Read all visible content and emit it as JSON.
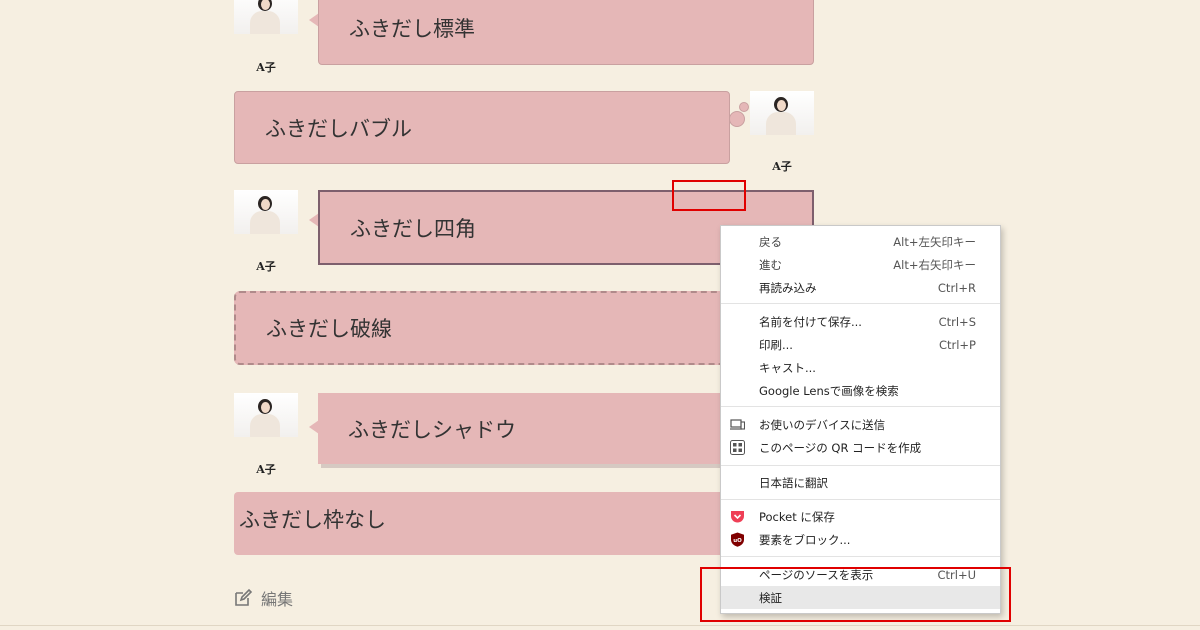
{
  "author_name": "A子",
  "bubbles": {
    "standard": "ふきだし標準",
    "bubble": "ふきだしバブル",
    "square": "ふきだし四角",
    "dashed": "ふきだし破線",
    "shadow": "ふきだしシャドウ",
    "noframe": "ふきだし枠なし"
  },
  "edit_label": "編集",
  "context_menu": {
    "items": [
      {
        "label": "戻る",
        "shortcut": "Alt+左矢印キー"
      },
      {
        "label": "進む",
        "shortcut": "Alt+右矢印キー"
      },
      {
        "label": "再読み込み",
        "shortcut": "Ctrl+R"
      },
      {
        "label": "名前を付けて保存...",
        "shortcut": "Ctrl+S"
      },
      {
        "label": "印刷...",
        "shortcut": "Ctrl+P"
      },
      {
        "label": "キャスト..."
      },
      {
        "label": "Google Lensで画像を検索"
      },
      {
        "label": "お使いのデバイスに送信",
        "icon": "device-send-icon"
      },
      {
        "label": "このページの QR コードを作成",
        "icon": "qr-code-icon"
      },
      {
        "label": "日本語に翻訳"
      },
      {
        "label": "Pocket に保存",
        "icon": "pocket-icon"
      },
      {
        "label": "要素をブロック...",
        "icon": "ublock-icon"
      },
      {
        "label": "ページのソースを表示",
        "shortcut": "Ctrl+U"
      },
      {
        "label": "検証"
      }
    ]
  },
  "colors": {
    "background": "#f6efe1",
    "bubble_fill": "#e5b7b7",
    "highlight_box": "#e00000",
    "pocket": "#ef3f56",
    "ublock": "#800000"
  }
}
